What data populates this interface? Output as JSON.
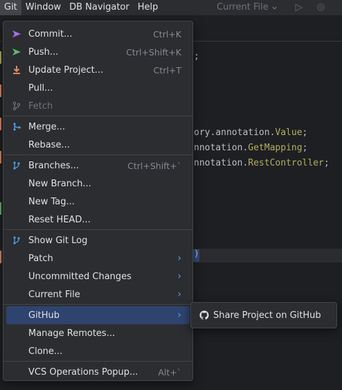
{
  "menubar": {
    "items": [
      {
        "name": "git",
        "label": "Git",
        "active": true
      },
      {
        "name": "window",
        "label": "Window"
      },
      {
        "name": "db-navigator",
        "label": "DB Navigator"
      },
      {
        "name": "help",
        "label": "Help"
      }
    ],
    "current_file": "Current File",
    "current_file_icon": "chevron-down-icon",
    "run_icon": "run-icon",
    "settings_icon": "gear-icon"
  },
  "editor": {
    "code_lines": [
      {
        "text": ";"
      },
      {
        "prefix": "ory.annotation.",
        "cls": "Value",
        "suffix": ";"
      },
      {
        "prefix": "nnotation.",
        "cls": "GetMapping",
        "suffix": ";"
      },
      {
        "prefix": "nnotation.",
        "cls": "RestController",
        "suffix": ";"
      },
      {
        "text": ")"
      }
    ]
  },
  "git_menu": {
    "groups": [
      [
        {
          "name": "commit",
          "label": "Commit...",
          "shortcut": "Ctrl+K",
          "icon": "commit-icon"
        },
        {
          "name": "push",
          "label": "Push...",
          "shortcut": "Ctrl+Shift+K",
          "icon": "push-icon"
        },
        {
          "name": "update-project",
          "label": "Update Project...",
          "shortcut": "Ctrl+T",
          "icon": "update-icon"
        },
        {
          "name": "pull",
          "label": "Pull..."
        },
        {
          "name": "fetch",
          "label": "Fetch",
          "icon": "fetch-icon",
          "disabled": true
        }
      ],
      [
        {
          "name": "merge",
          "label": "Merge...",
          "icon": "merge-icon"
        },
        {
          "name": "rebase",
          "label": "Rebase..."
        }
      ],
      [
        {
          "name": "branches",
          "label": "Branches...",
          "shortcut": "Ctrl+Shift+`",
          "icon": "branch-icon"
        },
        {
          "name": "new-branch",
          "label": "New Branch..."
        },
        {
          "name": "new-tag",
          "label": "New Tag..."
        },
        {
          "name": "reset-head",
          "label": "Reset HEAD..."
        }
      ],
      [
        {
          "name": "show-git-log",
          "label": "Show Git Log",
          "icon": "git-log-icon"
        },
        {
          "name": "patch",
          "label": "Patch",
          "submenu": true
        },
        {
          "name": "uncommitted-changes",
          "label": "Uncommitted Changes",
          "submenu": true
        },
        {
          "name": "current-file",
          "label": "Current File",
          "submenu": true
        }
      ],
      [
        {
          "name": "github",
          "label": "GitHub",
          "submenu": true,
          "selected": true
        },
        {
          "name": "manage-remotes",
          "label": "Manage Remotes..."
        },
        {
          "name": "clone",
          "label": "Clone..."
        }
      ],
      [
        {
          "name": "vcs-operations-popup",
          "label": "VCS Operations Popup...",
          "shortcut": "Alt+`"
        }
      ]
    ]
  },
  "github_submenu": {
    "items": [
      {
        "name": "share-project-on-github",
        "label": "Share Project on GitHub",
        "icon": "github-icon"
      }
    ]
  },
  "colors": {
    "accent": "#2e436e",
    "menu_bg": "#2b2d30",
    "commit_icon": "#a571e6",
    "push_icon": "#5fb865",
    "update_icon": "#e0885e",
    "branch_icon": "#4d9fe8",
    "annotation": "#b3ae60"
  }
}
